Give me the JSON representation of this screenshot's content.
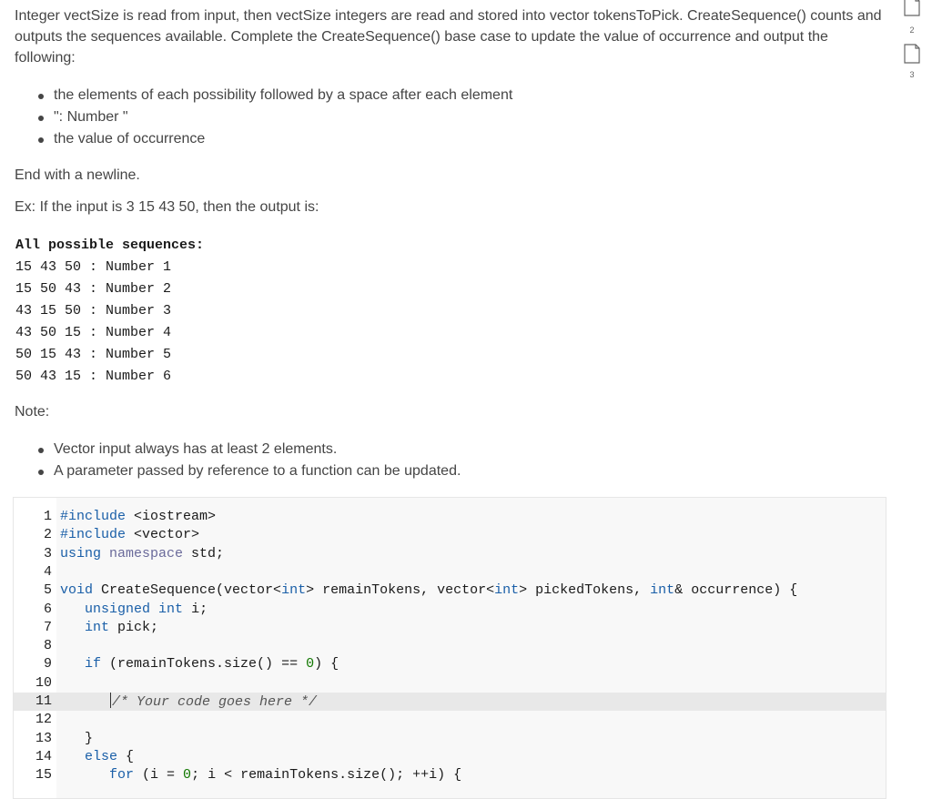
{
  "intro": "Integer vectSize is read from input, then vectSize integers are read and stored into vector tokensToPick. CreateSequence() counts and outputs the sequences available. Complete the CreateSequence() base case to update the value of occurrence and output the following:",
  "requirements": [
    "the elements of each possibility followed by a space after each element",
    "\": Number \"",
    "the value of occurrence"
  ],
  "end_note": "End with a newline.",
  "example_intro": "Ex: If the input is 3 15 43 50, then the output is:",
  "sample_output": [
    "All possible sequences:",
    "15 43 50 : Number 1",
    "15 50 43 : Number 2",
    "43 15 50 : Number 3",
    "43 50 15 : Number 4",
    "50 15 43 : Number 5",
    "50 43 15 : Number 6"
  ],
  "note_label": "Note:",
  "notes": [
    "Vector input always has at least 2 elements.",
    "A parameter passed by reference to a function can be updated."
  ],
  "side_pages": [
    {
      "icon": "page-icon",
      "number": "2"
    },
    {
      "icon": "page-icon",
      "number": "3"
    }
  ],
  "editor": {
    "active_line": 11,
    "lines": [
      {
        "n": "1",
        "text": "#include <iostream>"
      },
      {
        "n": "2",
        "text": "#include <vector>"
      },
      {
        "n": "3",
        "text": "using namespace std;"
      },
      {
        "n": "4",
        "text": ""
      },
      {
        "n": "5",
        "text": "void CreateSequence(vector<int> remainTokens, vector<int> pickedTokens, int& occurrence) {"
      },
      {
        "n": "6",
        "text": "   unsigned int i;"
      },
      {
        "n": "7",
        "text": "   int pick;"
      },
      {
        "n": "8",
        "text": ""
      },
      {
        "n": "9",
        "text": "   if (remainTokens.size() == 0) {"
      },
      {
        "n": "10",
        "text": ""
      },
      {
        "n": "11",
        "text": "      /* Your code goes here */"
      },
      {
        "n": "12",
        "text": ""
      },
      {
        "n": "13",
        "text": "   }"
      },
      {
        "n": "14",
        "text": "   else {"
      },
      {
        "n": "15",
        "text": "      for (i = 0; i < remainTokens.size(); ++i) {"
      }
    ]
  }
}
